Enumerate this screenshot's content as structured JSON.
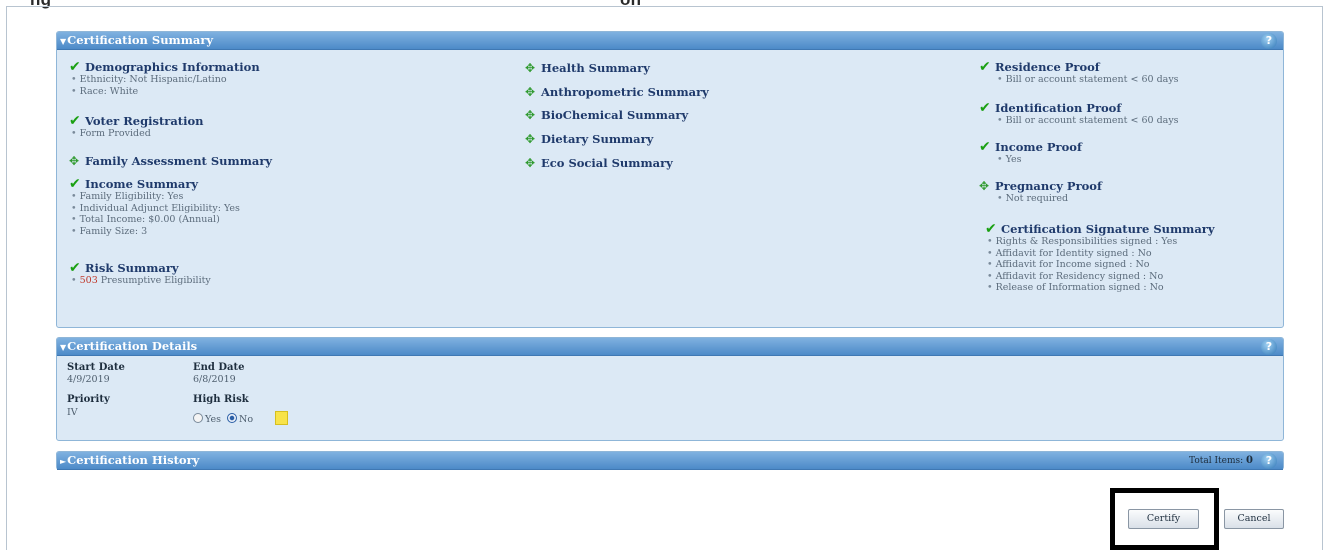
{
  "header_strip": {
    "left": "ng",
    "right": "on"
  },
  "summary": {
    "title": "Certification Summary",
    "demographics": {
      "title": "Demographics Information",
      "lines": [
        "Ethnicity: Not Hispanic/Latino",
        "Race: White"
      ]
    },
    "voter": {
      "title": "Voter Registration",
      "lines": [
        "Form Provided"
      ]
    },
    "family_assessment": {
      "title": "Family Assessment Summary"
    },
    "income": {
      "title": "Income Summary",
      "lines": [
        "Family Eligibility: Yes",
        "Individual Adjunct Eligibility: Yes",
        "Total Income: $0.00 (Annual)",
        "Family Size: 3"
      ]
    },
    "risk": {
      "title": "Risk Summary",
      "code": "503",
      "text": "Presumptive Eligibility"
    },
    "health": "Health Summary",
    "anthropometric": "Anthropometric Summary",
    "biochemical": "BioChemical Summary",
    "dietary": "Dietary Summary",
    "ecosocial": "Eco Social Summary",
    "residence": {
      "title": "Residence Proof",
      "lines": [
        "Bill or account statement < 60 days"
      ]
    },
    "identification": {
      "title": "Identification Proof",
      "lines": [
        "Bill or account statement < 60 days"
      ]
    },
    "income_proof": {
      "title": "Income Proof",
      "lines": [
        "Yes"
      ]
    },
    "pregnancy": {
      "title": "Pregnancy Proof",
      "lines": [
        "Not required"
      ]
    },
    "signature": {
      "title": "Certification Signature Summary",
      "lines": [
        "Rights & Responsibilities signed : Yes",
        "Affidavit for Identity signed : No",
        "Affidavit for Income signed : No",
        "Affidavit for Residency signed : No",
        "Release of Information signed : No"
      ]
    }
  },
  "details": {
    "title": "Certification Details",
    "start_date_label": "Start Date",
    "start_date": "4/9/2019",
    "end_date_label": "End Date",
    "end_date": "6/8/2019",
    "priority_label": "Priority",
    "priority": "IV",
    "high_risk_label": "High Risk",
    "yes_label": "Yes",
    "no_label": "No",
    "high_risk_selected": "No"
  },
  "history": {
    "title": "Certification History",
    "total_label": "Total Items:",
    "total_value": "0"
  },
  "actions": {
    "certify": "Certify",
    "cancel": "Cancel"
  },
  "colors": {
    "panel_header": "#4c8ac8",
    "panel_body": "#dce9f5",
    "check": "#1aa012",
    "link_title": "#1f3a6b"
  },
  "icons": {
    "complete": "check-icon",
    "pending": "diamond-arrows-icon",
    "help": "help-icon",
    "note": "sticky-note-icon"
  }
}
